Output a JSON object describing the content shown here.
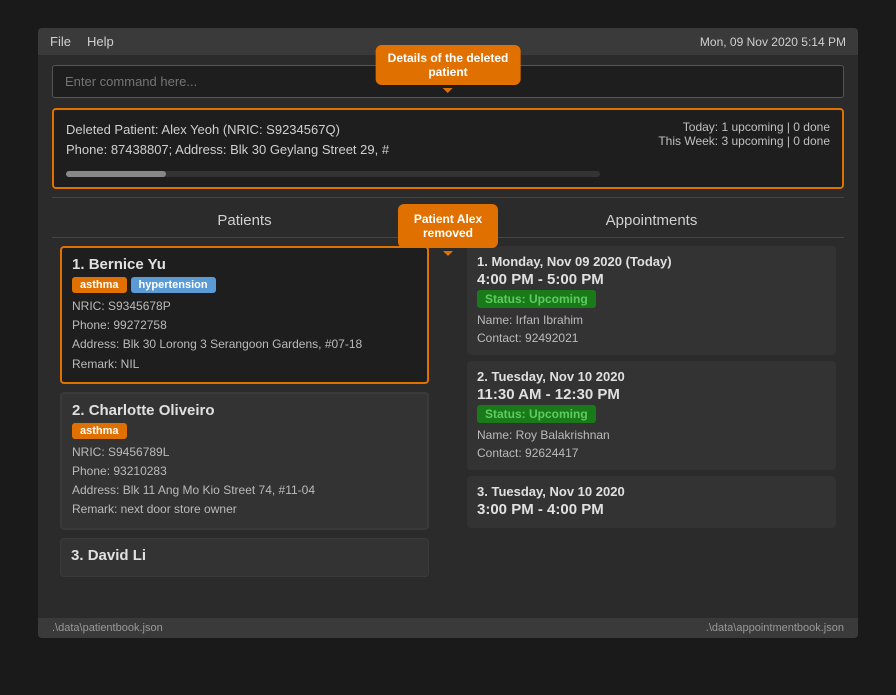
{
  "window": {
    "datetime": "Mon, 09 Nov 2020 5:14 PM"
  },
  "menu": {
    "file_label": "File",
    "help_label": "Help"
  },
  "command": {
    "placeholder": "Enter command here..."
  },
  "tooltip_deleted": {
    "line1": "Details of the deleted",
    "line2": "patient"
  },
  "result": {
    "text_line1": "Deleted Patient: Alex Yeoh (NRIC: S9234567Q)",
    "text_line2": "Phone: 87438807; Address: Blk 30 Geylang Street 29, #",
    "stats_today": "Today: 1 upcoming | 0 done",
    "stats_week": "This Week: 3 upcoming | 0 done"
  },
  "callout_removed": {
    "line1": "Patient Alex",
    "line2": "removed"
  },
  "panels": {
    "patients_title": "Patients",
    "appointments_title": "Appointments"
  },
  "patients": [
    {
      "number": "1.",
      "name": "Bernice Yu",
      "tags": [
        "asthma",
        "hypertension"
      ],
      "tag_colors": [
        "orange",
        "blue"
      ],
      "nric": "NRIC: S9345678P",
      "phone": "Phone: 99272758",
      "address": "Address: Blk 30 Lorong 3 Serangoon Gardens, #07-18",
      "remark": "Remark: NIL"
    },
    {
      "number": "2.",
      "name": "Charlotte Oliveiro",
      "tags": [
        "asthma"
      ],
      "tag_colors": [
        "orange"
      ],
      "nric": "NRIC: S9456789L",
      "phone": "Phone: 93210283",
      "address": "Address: Blk 11 Ang Mo Kio Street 74, #11-04",
      "remark": "Remark: next door store owner"
    },
    {
      "number": "3.",
      "name": "David Li",
      "tags": [],
      "tag_colors": [],
      "nric": "",
      "phone": "",
      "address": "",
      "remark": ""
    }
  ],
  "appointments": [
    {
      "number": "1.",
      "date": "Monday, Nov 09 2020 (Today)",
      "time": "4:00 PM - 5:00 PM",
      "status": "Status: Upcoming",
      "name": "Name: Irfan Ibrahim",
      "contact": "Contact: 92492021"
    },
    {
      "number": "2.",
      "date": "Tuesday, Nov 10 2020",
      "time": "11:30 AM - 12:30 PM",
      "status": "Status: Upcoming",
      "name": "Name: Roy Balakrishnan",
      "contact": "Contact: 92624417"
    },
    {
      "number": "3.",
      "date": "Tuesday, Nov 10 2020",
      "time": "3:00 PM - 4:00 PM",
      "status": "",
      "name": "",
      "contact": ""
    }
  ],
  "statusbar": {
    "left": ".\\data\\patientbook.json",
    "right": ".\\data\\appointmentbook.json"
  }
}
